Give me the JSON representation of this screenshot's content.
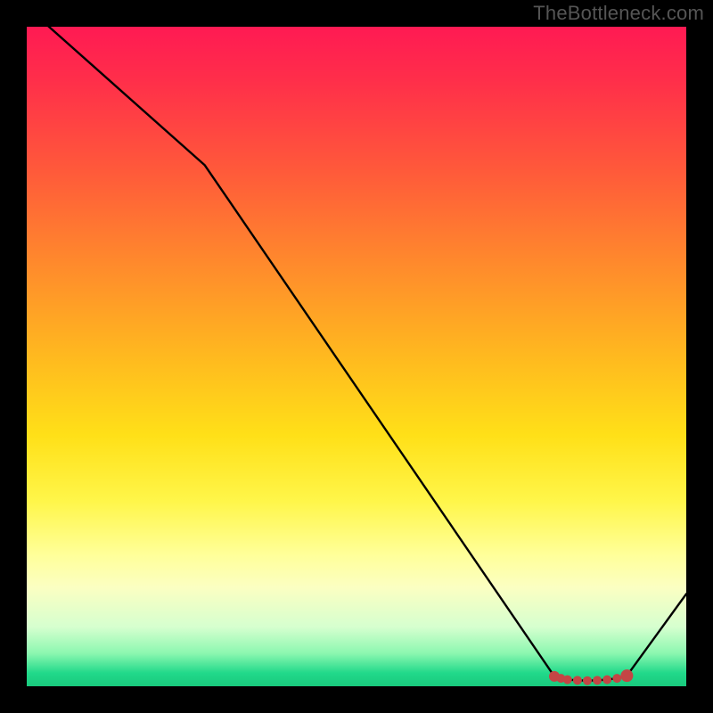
{
  "watermark": "TheBottleneck.com",
  "chart_data": {
    "type": "line",
    "title": "",
    "xlabel": "",
    "ylabel": "",
    "xlim": [
      0,
      100
    ],
    "ylim": [
      0,
      100
    ],
    "grid": false,
    "legend": false,
    "series": [
      {
        "name": "curve",
        "color": "#000000",
        "x": [
          0,
          27,
          80,
          81,
          82,
          83.5,
          85,
          86.5,
          88,
          89.5,
          91,
          100
        ],
        "values": [
          103,
          79,
          1.5,
          1.2,
          1.0,
          0.9,
          0.85,
          0.9,
          1.0,
          1.2,
          1.6,
          14
        ]
      }
    ],
    "markers": {
      "name": "flat-region-dots",
      "color": "#c44545",
      "x": [
        80,
        81,
        82,
        83.5,
        85,
        86.5,
        88,
        89.5,
        91
      ],
      "values": [
        1.5,
        1.2,
        1.0,
        0.9,
        0.85,
        0.9,
        1.0,
        1.2,
        1.6
      ],
      "radius": [
        6,
        5,
        5,
        5,
        5,
        5,
        5,
        5,
        7
      ]
    }
  }
}
